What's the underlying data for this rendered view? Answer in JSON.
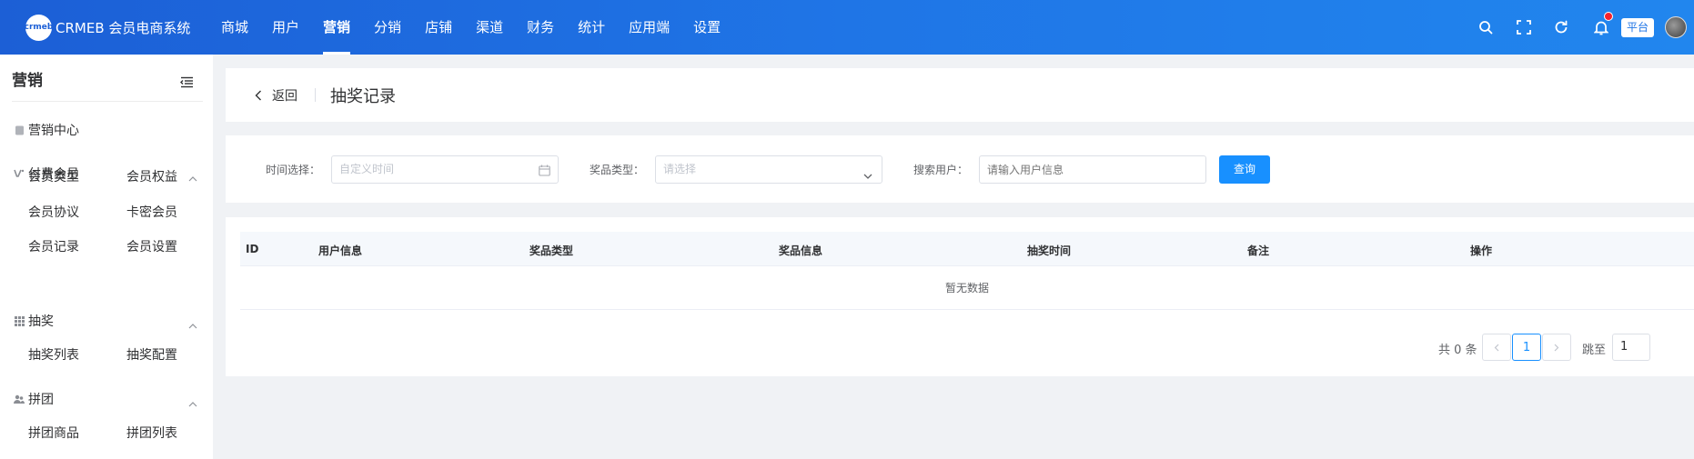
{
  "header": {
    "logo_mark": "crmeb",
    "logo_text": "CRMEB 会员电商系统",
    "nav": [
      "商城",
      "用户",
      "营销",
      "分销",
      "店铺",
      "渠道",
      "财务",
      "统计",
      "应用端",
      "设置"
    ],
    "active_nav": "营销",
    "platform_label": "平台",
    "icons": [
      "search-icon",
      "fullscreen-icon",
      "refresh-icon",
      "bell-icon"
    ],
    "notification_dot_color": "#f5222d"
  },
  "sidebar": {
    "title": "营销",
    "marketing_center": "营销中心",
    "groups": [
      {
        "label": "付费会员",
        "icon": "vip-icon",
        "items": [
          "会员类型",
          "会员权益",
          "会员协议",
          "卡密会员",
          "会员记录",
          "会员设置"
        ]
      },
      {
        "label": "抽奖",
        "icon": "grid-icon",
        "items": [
          "抽奖列表",
          "抽奖配置"
        ]
      },
      {
        "label": "拼团",
        "icon": "group-buy-icon",
        "items": [
          "拼团商品",
          "拼团列表"
        ]
      }
    ]
  },
  "page": {
    "back_label": "返回",
    "title": "抽奖记录"
  },
  "filters": {
    "time_label": "时间选择：",
    "time_placeholder": "自定义时间",
    "prize_type_label": "奖品类型：",
    "prize_type_placeholder": "请选择",
    "user_label": "搜索用户：",
    "user_placeholder": "请输入用户信息",
    "query_button": "查询"
  },
  "table": {
    "columns": [
      "ID",
      "用户信息",
      "奖品类型",
      "奖品信息",
      "抽奖时间",
      "备注",
      "操作"
    ],
    "empty_text": "暂无数据"
  },
  "pagination": {
    "total_text": "共 0 条",
    "current_page": "1",
    "goto_label": "跳至",
    "goto_value": "1"
  },
  "colors": {
    "header_gradient_start": "#1c5fd6",
    "header_gradient_end": "#2186ee",
    "primary": "#1890ff"
  }
}
